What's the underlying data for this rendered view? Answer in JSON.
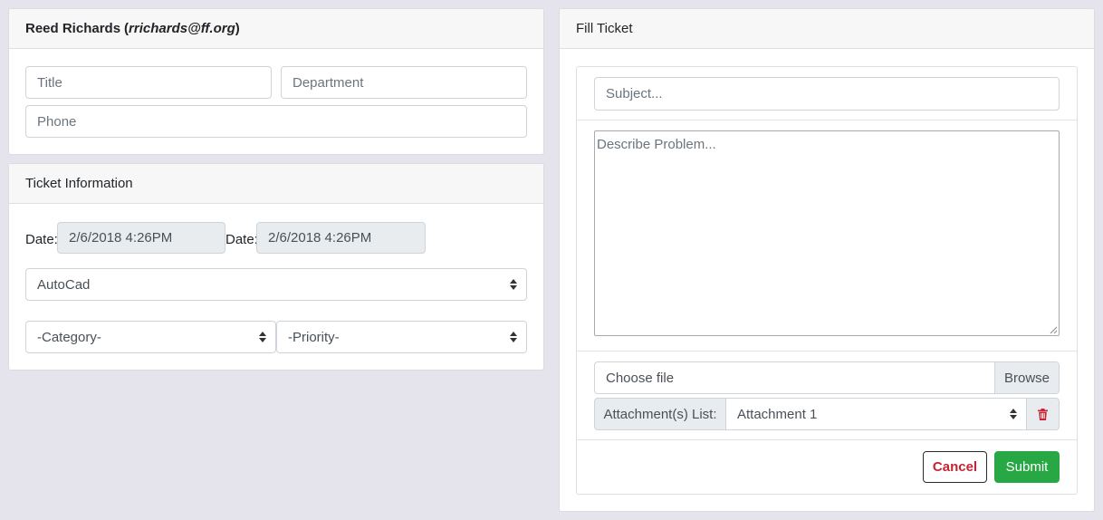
{
  "user_card": {
    "name": "Reed Richards",
    "email": "rrichards@ff.org",
    "title_placeholder": "Title",
    "department_placeholder": "Department",
    "phone_placeholder": "Phone"
  },
  "ticket_info": {
    "header": "Ticket Information",
    "date_label_1": "Date:",
    "date_value_1": "2/6/2018 4:26PM",
    "date_label_2": "Date:",
    "date_value_2": "2/6/2018 4:26PM",
    "software_selected": "AutoCad",
    "category_selected": "-Category-",
    "priority_selected": "-Priority-"
  },
  "fill_ticket": {
    "header": "Fill Ticket",
    "subject_placeholder": "Subject...",
    "describe_placeholder": "Describe Problem...",
    "file_placeholder": "Choose file",
    "browse_label": "Browse",
    "attachments_label": "Attachment(s) List:",
    "attachment_selected": "Attachment 1",
    "cancel_label": "Cancel",
    "submit_label": "Submit"
  },
  "colors": {
    "background": "#e5e3ec",
    "submit_green": "#28a745",
    "cancel_red": "#c82333",
    "trash_red": "#c82333"
  },
  "icons": {
    "select_arrow": "updown-caret-icon",
    "delete": "trash-icon"
  }
}
